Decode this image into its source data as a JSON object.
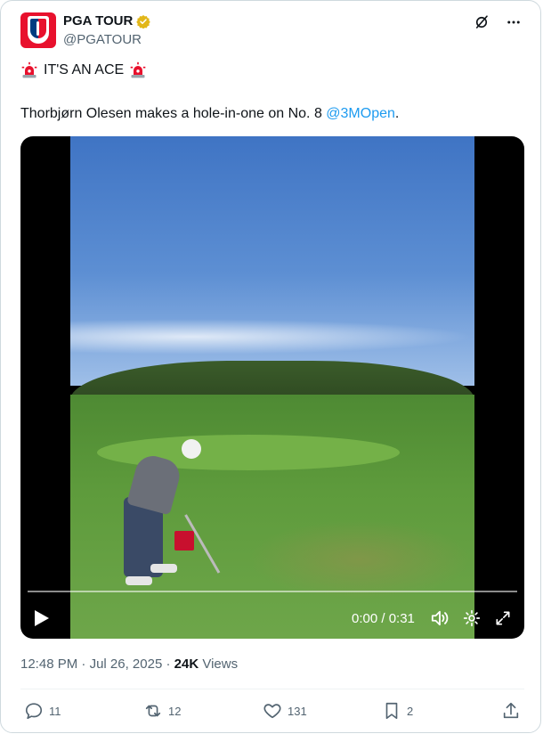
{
  "account": {
    "name": "PGA TOUR",
    "handle": "@PGATOUR"
  },
  "post": {
    "line1": "IT'S AN ACE",
    "line2_prefix": "Thorbjørn Olesen makes a hole-in-one on No. 8 ",
    "line2_mention": "@3MOpen",
    "line2_suffix": "."
  },
  "video": {
    "time": "0:00 / 0:31",
    "progress": 0.0
  },
  "meta": {
    "time": "12:48 PM",
    "sep1": " · ",
    "date": "Jul 26, 2025",
    "sep2": " · ",
    "views_count": "24K",
    "views_label": " Views"
  },
  "actions": {
    "replies": "11",
    "reposts": "12",
    "likes": "131",
    "bookmarks": "2"
  },
  "icons": {
    "verified": "verified-badge-icon",
    "grok": "grok-icon",
    "more": "more-icon",
    "siren": "siren-icon"
  },
  "colors": {
    "accent": "#1d9bf0",
    "brand_red": "#e8112d",
    "brand_blue": "#003c80",
    "verified_gold": "#e2b719"
  }
}
